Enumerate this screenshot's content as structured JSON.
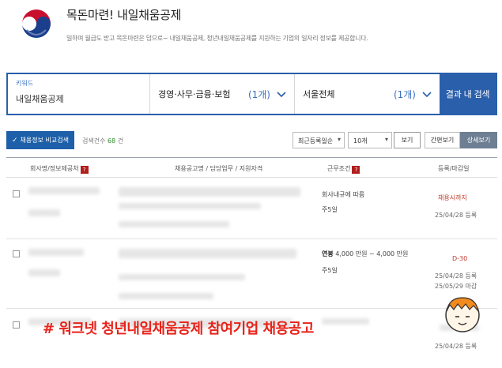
{
  "header": {
    "title": "목돈마련! 내일채움공제",
    "subtitle": "일하며 월급도 받고 목돈마련은 덤으로~ 내일채움공제, 청년내일채움공제를 지원하는 기업의 일자리 정보를 제공합니다."
  },
  "search": {
    "keyword_label": "키워드",
    "keyword_value": "내일채움공제",
    "category": "경영·사무·금융·보험",
    "category_count": "(1개)",
    "region": "서울전체",
    "region_count": "(1개)",
    "button": "결과 내 검색"
  },
  "toolbar": {
    "compare_check": "✓",
    "compare_label": "채용정보 비교검색",
    "result_prefix": "검색건수",
    "result_count": "68",
    "result_suffix": "건",
    "sort_value": "최근등록일순",
    "per_page_value": "10개",
    "view_button": "보기",
    "simple_view": "간편보기",
    "detail_view": "상세보기"
  },
  "table": {
    "headers": {
      "company": "회사명/정보제공처",
      "title": "채용공고명 / 담당업무 / 지원자격",
      "conditions": "근무조건",
      "date": "등록/마감일"
    },
    "qmark": "?",
    "rows": [
      {
        "conditions": [
          "회사내규에 따름",
          "주5일"
        ],
        "deadline": "채용시까지",
        "registered": "25/04/28 등록"
      },
      {
        "salary_label": "연봉",
        "salary": "4,000 만원 ~ 4,000 만원",
        "workdays": "주5일",
        "dday": "D-30",
        "registered": "25/04/28 등록",
        "closing": "25/05/29 마감"
      },
      {
        "registered": "25/04/28 등록"
      }
    ]
  },
  "overlay": {
    "caption": "# 워크넷 청년내일채움공제 참여기업 채용공고"
  },
  "colors": {
    "accent": "#2a5fab",
    "highlight": "#e8231a"
  }
}
